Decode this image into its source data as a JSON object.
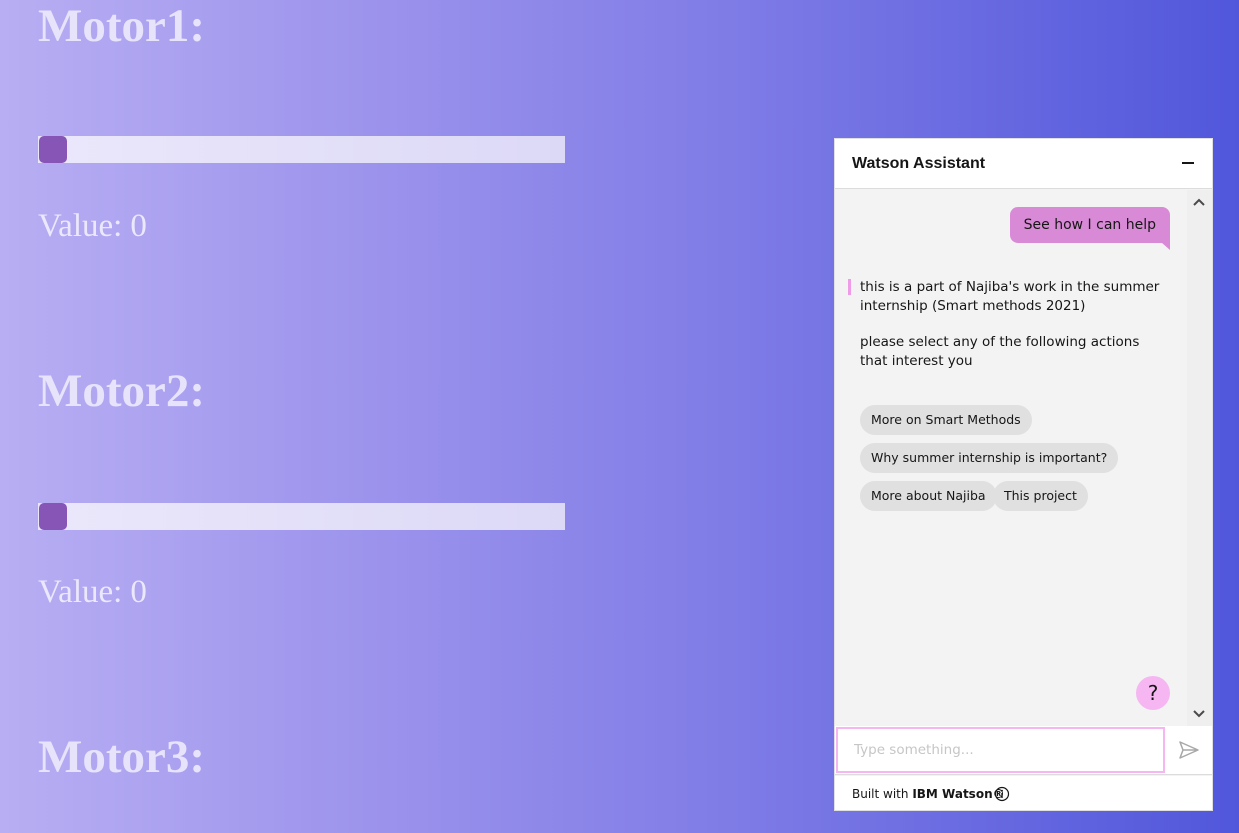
{
  "motors": [
    {
      "title": "Motor1:",
      "value_label": "Value:",
      "value": "0",
      "slider_fraction": 0
    },
    {
      "title": "Motor2:",
      "value_label": "Value:",
      "value": "0",
      "slider_fraction": 0
    },
    {
      "title": "Motor3:"
    }
  ],
  "assistant": {
    "title": "Watson Assistant",
    "user_message": "See how I can help",
    "bot_messages": [
      "this is a part of Najiba's work in the summer internship (Smart methods 2021)",
      "please select any of the following actions that interest you"
    ],
    "options": [
      "More on Smart Methods",
      "Why summer internship is important?",
      "More about Najiba",
      "This project"
    ],
    "help_label": "?",
    "input_placeholder": "Type something...",
    "footer_prefix": "Built with",
    "footer_brand": "IBM Watson®"
  },
  "colors": {
    "slider_thumb": "#8655b5",
    "user_bubble": "#d88ad6",
    "accent_pink": "#f5b6f2",
    "background_start": "#b8aef3",
    "background_end": "#5157db"
  },
  "icons": {
    "minimize": "minimize-icon",
    "scroll_up": "chevron-up-icon",
    "scroll_down": "chevron-down-icon",
    "send": "send-icon",
    "info": "info-icon",
    "help": "help-icon"
  }
}
